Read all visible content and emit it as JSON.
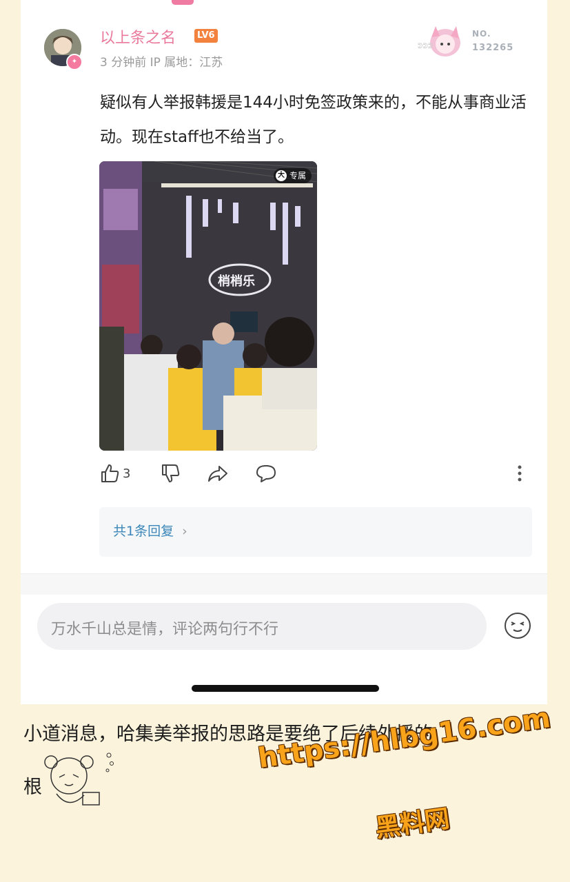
{
  "post": {
    "username": "以上条之名",
    "level": "LV6",
    "meta": "3 分钟前  IP 属地：江苏",
    "no_label": "NO.",
    "no_number": "132265",
    "text": "疑似有人举报韩援是144小时免签政策来的，不能从事商业活动。现在staff也不给当了。",
    "image_tag": "专属",
    "image_tag_glyph": "大",
    "sign_text": "ᕲᕲᕲ"
  },
  "actions": {
    "like_count": "3"
  },
  "reply": {
    "label": "共1条回复"
  },
  "comment": {
    "placeholder": "万水千山总是情，评论两句行不行"
  },
  "caption": {
    "line1": "小道消息，哈集美举报的思路是要绝了后续外援的",
    "line2": "根"
  },
  "watermark": {
    "url": "https://hlbg16.com",
    "name": "黑料网"
  },
  "colors": {
    "username": "#ea7a9c",
    "level_badge": "#f3823f",
    "reply_link": "#3b86b8",
    "watermark": "#f9a31b"
  }
}
